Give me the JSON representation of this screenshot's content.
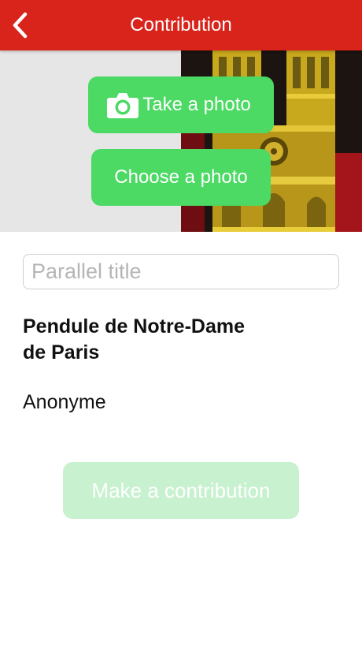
{
  "nav": {
    "title": "Contribution",
    "back_icon": "chevron-left-icon",
    "bar_color": "#d9241c"
  },
  "photo_area": {
    "take_photo_label": "Take a photo",
    "take_photo_icon": "camera-icon",
    "choose_photo_label": "Choose a photo",
    "button_color": "#4cd964"
  },
  "form": {
    "parallel_title_placeholder": "Parallel title",
    "parallel_title_value": ""
  },
  "artwork": {
    "title_line1": "Pendule de Notre-Dame",
    "title_line2": "de Paris",
    "artist": "Anonyme"
  },
  "actions": {
    "contribute_label": "Make a contribution",
    "contribute_disabled": true,
    "disabled_color": "#c7f1cf"
  }
}
